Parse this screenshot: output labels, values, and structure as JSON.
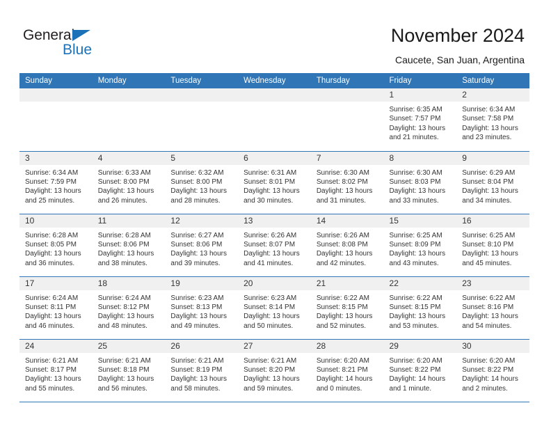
{
  "logo": {
    "name_top": "General",
    "name_bottom": "Blue",
    "triangle_color": "#1b72b8",
    "text_color": "#231f20"
  },
  "header": {
    "title": "November 2024",
    "subtitle": "Caucete, San Juan, Argentina"
  },
  "theme": {
    "header_blue": "#3075b5",
    "daynum_band": "#f0f0f0",
    "text": "#333333"
  },
  "calendar": {
    "weekday_headers": [
      "Sunday",
      "Monday",
      "Tuesday",
      "Wednesday",
      "Thursday",
      "Friday",
      "Saturday"
    ],
    "weeks": [
      [
        {
          "day": "",
          "lines": []
        },
        {
          "day": "",
          "lines": []
        },
        {
          "day": "",
          "lines": []
        },
        {
          "day": "",
          "lines": []
        },
        {
          "day": "",
          "lines": []
        },
        {
          "day": "1",
          "lines": [
            "Sunrise: 6:35 AM",
            "Sunset: 7:57 PM",
            "Daylight: 13 hours",
            "and 21 minutes."
          ]
        },
        {
          "day": "2",
          "lines": [
            "Sunrise: 6:34 AM",
            "Sunset: 7:58 PM",
            "Daylight: 13 hours",
            "and 23 minutes."
          ]
        }
      ],
      [
        {
          "day": "3",
          "lines": [
            "Sunrise: 6:34 AM",
            "Sunset: 7:59 PM",
            "Daylight: 13 hours",
            "and 25 minutes."
          ]
        },
        {
          "day": "4",
          "lines": [
            "Sunrise: 6:33 AM",
            "Sunset: 8:00 PM",
            "Daylight: 13 hours",
            "and 26 minutes."
          ]
        },
        {
          "day": "5",
          "lines": [
            "Sunrise: 6:32 AM",
            "Sunset: 8:00 PM",
            "Daylight: 13 hours",
            "and 28 minutes."
          ]
        },
        {
          "day": "6",
          "lines": [
            "Sunrise: 6:31 AM",
            "Sunset: 8:01 PM",
            "Daylight: 13 hours",
            "and 30 minutes."
          ]
        },
        {
          "day": "7",
          "lines": [
            "Sunrise: 6:30 AM",
            "Sunset: 8:02 PM",
            "Daylight: 13 hours",
            "and 31 minutes."
          ]
        },
        {
          "day": "8",
          "lines": [
            "Sunrise: 6:30 AM",
            "Sunset: 8:03 PM",
            "Daylight: 13 hours",
            "and 33 minutes."
          ]
        },
        {
          "day": "9",
          "lines": [
            "Sunrise: 6:29 AM",
            "Sunset: 8:04 PM",
            "Daylight: 13 hours",
            "and 34 minutes."
          ]
        }
      ],
      [
        {
          "day": "10",
          "lines": [
            "Sunrise: 6:28 AM",
            "Sunset: 8:05 PM",
            "Daylight: 13 hours",
            "and 36 minutes."
          ]
        },
        {
          "day": "11",
          "lines": [
            "Sunrise: 6:28 AM",
            "Sunset: 8:06 PM",
            "Daylight: 13 hours",
            "and 38 minutes."
          ]
        },
        {
          "day": "12",
          "lines": [
            "Sunrise: 6:27 AM",
            "Sunset: 8:06 PM",
            "Daylight: 13 hours",
            "and 39 minutes."
          ]
        },
        {
          "day": "13",
          "lines": [
            "Sunrise: 6:26 AM",
            "Sunset: 8:07 PM",
            "Daylight: 13 hours",
            "and 41 minutes."
          ]
        },
        {
          "day": "14",
          "lines": [
            "Sunrise: 6:26 AM",
            "Sunset: 8:08 PM",
            "Daylight: 13 hours",
            "and 42 minutes."
          ]
        },
        {
          "day": "15",
          "lines": [
            "Sunrise: 6:25 AM",
            "Sunset: 8:09 PM",
            "Daylight: 13 hours",
            "and 43 minutes."
          ]
        },
        {
          "day": "16",
          "lines": [
            "Sunrise: 6:25 AM",
            "Sunset: 8:10 PM",
            "Daylight: 13 hours",
            "and 45 minutes."
          ]
        }
      ],
      [
        {
          "day": "17",
          "lines": [
            "Sunrise: 6:24 AM",
            "Sunset: 8:11 PM",
            "Daylight: 13 hours",
            "and 46 minutes."
          ]
        },
        {
          "day": "18",
          "lines": [
            "Sunrise: 6:24 AM",
            "Sunset: 8:12 PM",
            "Daylight: 13 hours",
            "and 48 minutes."
          ]
        },
        {
          "day": "19",
          "lines": [
            "Sunrise: 6:23 AM",
            "Sunset: 8:13 PM",
            "Daylight: 13 hours",
            "and 49 minutes."
          ]
        },
        {
          "day": "20",
          "lines": [
            "Sunrise: 6:23 AM",
            "Sunset: 8:14 PM",
            "Daylight: 13 hours",
            "and 50 minutes."
          ]
        },
        {
          "day": "21",
          "lines": [
            "Sunrise: 6:22 AM",
            "Sunset: 8:15 PM",
            "Daylight: 13 hours",
            "and 52 minutes."
          ]
        },
        {
          "day": "22",
          "lines": [
            "Sunrise: 6:22 AM",
            "Sunset: 8:15 PM",
            "Daylight: 13 hours",
            "and 53 minutes."
          ]
        },
        {
          "day": "23",
          "lines": [
            "Sunrise: 6:22 AM",
            "Sunset: 8:16 PM",
            "Daylight: 13 hours",
            "and 54 minutes."
          ]
        }
      ],
      [
        {
          "day": "24",
          "lines": [
            "Sunrise: 6:21 AM",
            "Sunset: 8:17 PM",
            "Daylight: 13 hours",
            "and 55 minutes."
          ]
        },
        {
          "day": "25",
          "lines": [
            "Sunrise: 6:21 AM",
            "Sunset: 8:18 PM",
            "Daylight: 13 hours",
            "and 56 minutes."
          ]
        },
        {
          "day": "26",
          "lines": [
            "Sunrise: 6:21 AM",
            "Sunset: 8:19 PM",
            "Daylight: 13 hours",
            "and 58 minutes."
          ]
        },
        {
          "day": "27",
          "lines": [
            "Sunrise: 6:21 AM",
            "Sunset: 8:20 PM",
            "Daylight: 13 hours",
            "and 59 minutes."
          ]
        },
        {
          "day": "28",
          "lines": [
            "Sunrise: 6:20 AM",
            "Sunset: 8:21 PM",
            "Daylight: 14 hours",
            "and 0 minutes."
          ]
        },
        {
          "day": "29",
          "lines": [
            "Sunrise: 6:20 AM",
            "Sunset: 8:22 PM",
            "Daylight: 14 hours",
            "and 1 minute."
          ]
        },
        {
          "day": "30",
          "lines": [
            "Sunrise: 6:20 AM",
            "Sunset: 8:22 PM",
            "Daylight: 14 hours",
            "and 2 minutes."
          ]
        }
      ]
    ]
  }
}
